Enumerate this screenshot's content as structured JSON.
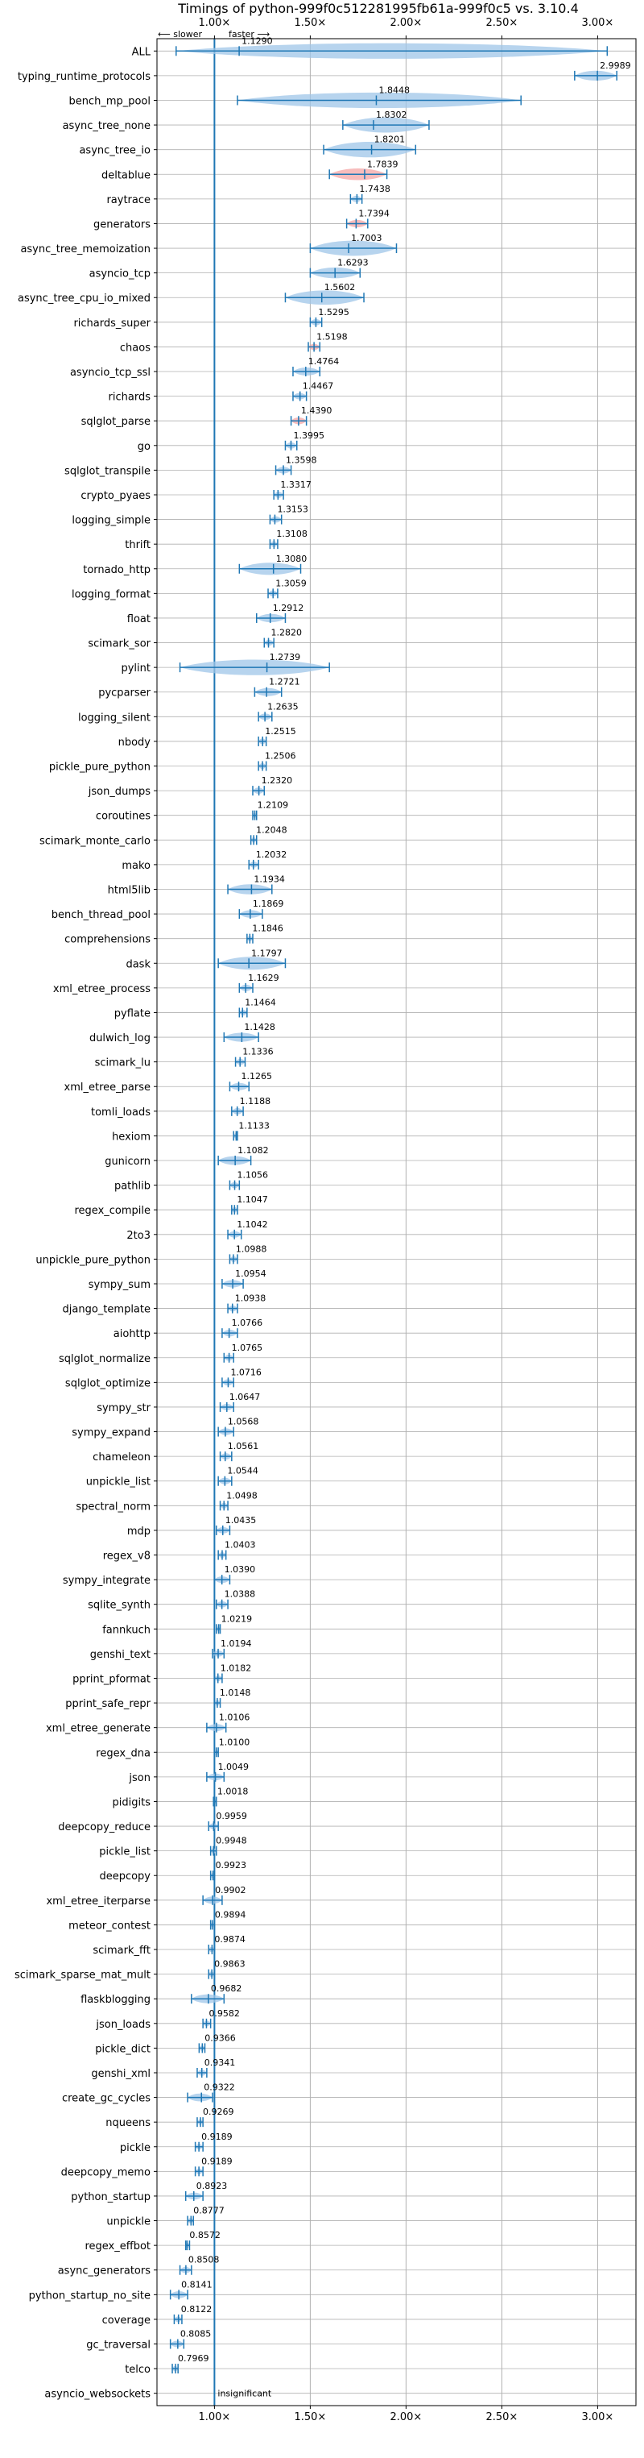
{
  "chart_data": {
    "type": "violin",
    "title": "Timings of python-999f0c512281995fb61a-999f0c5 vs. 3.10.4",
    "direction_labels": {
      "slower": "⟵ slower",
      "faster": "faster ⟶"
    },
    "x_ticks": [
      {
        "value": 1.0,
        "label": "1.00×"
      },
      {
        "value": 1.5,
        "label": "1.50×"
      },
      {
        "value": 2.0,
        "label": "2.00×"
      },
      {
        "value": 2.5,
        "label": "2.50×"
      },
      {
        "value": 3.0,
        "label": "3.00×"
      }
    ],
    "xlim": [
      0.7,
      3.2
    ],
    "grid": true,
    "colors": {
      "violin": "#9fc5e8",
      "line": "#1f77b4",
      "highlight": "#f4a6a6",
      "grid": "#b0b0b0"
    },
    "insignificant_label": "insignificant",
    "benchmarks": [
      {
        "name": "ALL",
        "value": 1.129,
        "label": "1.1290",
        "lo": 0.8,
        "hi": 3.05
      },
      {
        "name": "typing_runtime_protocols",
        "value": 2.9989,
        "label": "2.9989",
        "lo": 2.88,
        "hi": 3.1
      },
      {
        "name": "bench_mp_pool",
        "value": 1.8448,
        "label": "1.8448",
        "lo": 1.12,
        "hi": 2.6
      },
      {
        "name": "async_tree_none",
        "value": 1.8302,
        "label": "1.8302",
        "lo": 1.67,
        "hi": 2.12
      },
      {
        "name": "async_tree_io",
        "value": 1.8201,
        "label": "1.8201",
        "lo": 1.57,
        "hi": 2.05
      },
      {
        "name": "deltablue",
        "value": 1.7839,
        "label": "1.7839",
        "lo": 1.6,
        "hi": 1.9,
        "highlight": true
      },
      {
        "name": "raytrace",
        "value": 1.7438,
        "label": "1.7438",
        "lo": 1.71,
        "hi": 1.77
      },
      {
        "name": "generators",
        "value": 1.7394,
        "label": "1.7394",
        "lo": 1.69,
        "hi": 1.8,
        "highlight": true
      },
      {
        "name": "async_tree_memoization",
        "value": 1.7003,
        "label": "1.7003",
        "lo": 1.5,
        "hi": 1.95
      },
      {
        "name": "asyncio_tcp",
        "value": 1.6293,
        "label": "1.6293",
        "lo": 1.5,
        "hi": 1.76
      },
      {
        "name": "async_tree_cpu_io_mixed",
        "value": 1.5602,
        "label": "1.5602",
        "lo": 1.37,
        "hi": 1.78
      },
      {
        "name": "richards_super",
        "value": 1.5295,
        "label": "1.5295",
        "lo": 1.5,
        "hi": 1.56
      },
      {
        "name": "chaos",
        "value": 1.5198,
        "label": "1.5198",
        "lo": 1.49,
        "hi": 1.55,
        "highlight": true
      },
      {
        "name": "asyncio_tcp_ssl",
        "value": 1.4764,
        "label": "1.4764",
        "lo": 1.41,
        "hi": 1.55
      },
      {
        "name": "richards",
        "value": 1.4467,
        "label": "1.4467",
        "lo": 1.41,
        "hi": 1.48
      },
      {
        "name": "sqlglot_parse",
        "value": 1.439,
        "label": "1.4390",
        "lo": 1.4,
        "hi": 1.48,
        "highlight": true
      },
      {
        "name": "go",
        "value": 1.3995,
        "label": "1.3995",
        "lo": 1.37,
        "hi": 1.43
      },
      {
        "name": "sqlglot_transpile",
        "value": 1.3598,
        "label": "1.3598",
        "lo": 1.32,
        "hi": 1.4
      },
      {
        "name": "crypto_pyaes",
        "value": 1.3317,
        "label": "1.3317",
        "lo": 1.31,
        "hi": 1.36
      },
      {
        "name": "logging_simple",
        "value": 1.3153,
        "label": "1.3153",
        "lo": 1.29,
        "hi": 1.35
      },
      {
        "name": "thrift",
        "value": 1.3108,
        "label": "1.3108",
        "lo": 1.29,
        "hi": 1.33
      },
      {
        "name": "tornado_http",
        "value": 1.308,
        "label": "1.3080",
        "lo": 1.13,
        "hi": 1.45
      },
      {
        "name": "logging_format",
        "value": 1.3059,
        "label": "1.3059",
        "lo": 1.28,
        "hi": 1.33
      },
      {
        "name": "float",
        "value": 1.2912,
        "label": "1.2912",
        "lo": 1.22,
        "hi": 1.37
      },
      {
        "name": "scimark_sor",
        "value": 1.282,
        "label": "1.2820",
        "lo": 1.26,
        "hi": 1.31
      },
      {
        "name": "pylint",
        "value": 1.2739,
        "label": "1.2739",
        "lo": 0.82,
        "hi": 1.6
      },
      {
        "name": "pycparser",
        "value": 1.2721,
        "label": "1.2721",
        "lo": 1.21,
        "hi": 1.35
      },
      {
        "name": "logging_silent",
        "value": 1.2635,
        "label": "1.2635",
        "lo": 1.23,
        "hi": 1.3
      },
      {
        "name": "nbody",
        "value": 1.2515,
        "label": "1.2515",
        "lo": 1.23,
        "hi": 1.27
      },
      {
        "name": "pickle_pure_python",
        "value": 1.2506,
        "label": "1.2506",
        "lo": 1.23,
        "hi": 1.27
      },
      {
        "name": "json_dumps",
        "value": 1.232,
        "label": "1.2320",
        "lo": 1.2,
        "hi": 1.26
      },
      {
        "name": "coroutines",
        "value": 1.2109,
        "label": "1.2109",
        "lo": 1.2,
        "hi": 1.22
      },
      {
        "name": "scimark_monte_carlo",
        "value": 1.2048,
        "label": "1.2048",
        "lo": 1.19,
        "hi": 1.22
      },
      {
        "name": "mako",
        "value": 1.2032,
        "label": "1.2032",
        "lo": 1.18,
        "hi": 1.23
      },
      {
        "name": "html5lib",
        "value": 1.1934,
        "label": "1.1934",
        "lo": 1.07,
        "hi": 1.3
      },
      {
        "name": "bench_thread_pool",
        "value": 1.1869,
        "label": "1.1869",
        "lo": 1.13,
        "hi": 1.25
      },
      {
        "name": "comprehensions",
        "value": 1.1846,
        "label": "1.1846",
        "lo": 1.17,
        "hi": 1.2
      },
      {
        "name": "dask",
        "value": 1.1797,
        "label": "1.1797",
        "lo": 1.02,
        "hi": 1.37
      },
      {
        "name": "xml_etree_process",
        "value": 1.1629,
        "label": "1.1629",
        "lo": 1.13,
        "hi": 1.2
      },
      {
        "name": "pyflate",
        "value": 1.1464,
        "label": "1.1464",
        "lo": 1.13,
        "hi": 1.17
      },
      {
        "name": "dulwich_log",
        "value": 1.1428,
        "label": "1.1428",
        "lo": 1.05,
        "hi": 1.23
      },
      {
        "name": "scimark_lu",
        "value": 1.1336,
        "label": "1.1336",
        "lo": 1.11,
        "hi": 1.16
      },
      {
        "name": "xml_etree_parse",
        "value": 1.1265,
        "label": "1.1265",
        "lo": 1.08,
        "hi": 1.18
      },
      {
        "name": "tomli_loads",
        "value": 1.1188,
        "label": "1.1188",
        "lo": 1.09,
        "hi": 1.15
      },
      {
        "name": "hexiom",
        "value": 1.1133,
        "label": "1.1133",
        "lo": 1.1,
        "hi": 1.12
      },
      {
        "name": "gunicorn",
        "value": 1.1082,
        "label": "1.1082",
        "lo": 1.02,
        "hi": 1.19
      },
      {
        "name": "pathlib",
        "value": 1.1056,
        "label": "1.1056",
        "lo": 1.08,
        "hi": 1.13
      },
      {
        "name": "regex_compile",
        "value": 1.1047,
        "label": "1.1047",
        "lo": 1.09,
        "hi": 1.12
      },
      {
        "name": "2to3",
        "value": 1.1042,
        "label": "1.1042",
        "lo": 1.07,
        "hi": 1.14
      },
      {
        "name": "unpickle_pure_python",
        "value": 1.0988,
        "label": "1.0988",
        "lo": 1.08,
        "hi": 1.12
      },
      {
        "name": "sympy_sum",
        "value": 1.0954,
        "label": "1.0954",
        "lo": 1.04,
        "hi": 1.15
      },
      {
        "name": "django_template",
        "value": 1.0938,
        "label": "1.0938",
        "lo": 1.07,
        "hi": 1.12
      },
      {
        "name": "aiohttp",
        "value": 1.0766,
        "label": "1.0766",
        "lo": 1.04,
        "hi": 1.12
      },
      {
        "name": "sqlglot_normalize",
        "value": 1.0765,
        "label": "1.0765",
        "lo": 1.05,
        "hi": 1.1
      },
      {
        "name": "sqlglot_optimize",
        "value": 1.0716,
        "label": "1.0716",
        "lo": 1.04,
        "hi": 1.1
      },
      {
        "name": "sympy_str",
        "value": 1.0647,
        "label": "1.0647",
        "lo": 1.03,
        "hi": 1.1
      },
      {
        "name": "sympy_expand",
        "value": 1.0568,
        "label": "1.0568",
        "lo": 1.02,
        "hi": 1.1
      },
      {
        "name": "chameleon",
        "value": 1.0561,
        "label": "1.0561",
        "lo": 1.03,
        "hi": 1.09
      },
      {
        "name": "unpickle_list",
        "value": 1.0544,
        "label": "1.0544",
        "lo": 1.02,
        "hi": 1.09
      },
      {
        "name": "spectral_norm",
        "value": 1.0498,
        "label": "1.0498",
        "lo": 1.03,
        "hi": 1.07
      },
      {
        "name": "mdp",
        "value": 1.0435,
        "label": "1.0435",
        "lo": 1.01,
        "hi": 1.08
      },
      {
        "name": "regex_v8",
        "value": 1.0403,
        "label": "1.0403",
        "lo": 1.02,
        "hi": 1.06
      },
      {
        "name": "sympy_integrate",
        "value": 1.039,
        "label": "1.0390",
        "lo": 1.0,
        "hi": 1.08
      },
      {
        "name": "sqlite_synth",
        "value": 1.0388,
        "label": "1.0388",
        "lo": 1.01,
        "hi": 1.07
      },
      {
        "name": "fannkuch",
        "value": 1.0219,
        "label": "1.0219",
        "lo": 1.01,
        "hi": 1.03
      },
      {
        "name": "genshi_text",
        "value": 1.0194,
        "label": "1.0194",
        "lo": 0.99,
        "hi": 1.05
      },
      {
        "name": "pprint_pformat",
        "value": 1.0182,
        "label": "1.0182",
        "lo": 1.0,
        "hi": 1.04
      },
      {
        "name": "pprint_safe_repr",
        "value": 1.0148,
        "label": "1.0148",
        "lo": 1.0,
        "hi": 1.03
      },
      {
        "name": "xml_etree_generate",
        "value": 1.0106,
        "label": "1.0106",
        "lo": 0.96,
        "hi": 1.06
      },
      {
        "name": "regex_dna",
        "value": 1.01,
        "label": "1.0100",
        "lo": 1.0,
        "hi": 1.02
      },
      {
        "name": "json",
        "value": 1.0049,
        "label": "1.0049",
        "lo": 0.96,
        "hi": 1.05
      },
      {
        "name": "pidigits",
        "value": 1.0018,
        "label": "1.0018",
        "lo": 0.995,
        "hi": 1.01
      },
      {
        "name": "deepcopy_reduce",
        "value": 0.9959,
        "label": "0.9959",
        "lo": 0.97,
        "hi": 1.02
      },
      {
        "name": "pickle_list",
        "value": 0.9948,
        "label": "0.9948",
        "lo": 0.98,
        "hi": 1.01
      },
      {
        "name": "deepcopy",
        "value": 0.9923,
        "label": "0.9923",
        "lo": 0.98,
        "hi": 1.0
      },
      {
        "name": "xml_etree_iterparse",
        "value": 0.9902,
        "label": "0.9902",
        "lo": 0.94,
        "hi": 1.04
      },
      {
        "name": "meteor_contest",
        "value": 0.9894,
        "label": "0.9894",
        "lo": 0.98,
        "hi": 1.0
      },
      {
        "name": "scimark_fft",
        "value": 0.9874,
        "label": "0.9874",
        "lo": 0.97,
        "hi": 1.0
      },
      {
        "name": "scimark_sparse_mat_mult",
        "value": 0.9863,
        "label": "0.9863",
        "lo": 0.97,
        "hi": 1.0
      },
      {
        "name": "flaskblogging",
        "value": 0.9682,
        "label": "0.9682",
        "lo": 0.88,
        "hi": 1.05
      },
      {
        "name": "json_loads",
        "value": 0.9582,
        "label": "0.9582",
        "lo": 0.94,
        "hi": 0.98
      },
      {
        "name": "pickle_dict",
        "value": 0.9366,
        "label": "0.9366",
        "lo": 0.92,
        "hi": 0.95
      },
      {
        "name": "genshi_xml",
        "value": 0.9341,
        "label": "0.9341",
        "lo": 0.91,
        "hi": 0.96
      },
      {
        "name": "create_gc_cycles",
        "value": 0.9322,
        "label": "0.9322",
        "lo": 0.86,
        "hi": 0.99
      },
      {
        "name": "nqueens",
        "value": 0.9269,
        "label": "0.9269",
        "lo": 0.91,
        "hi": 0.94
      },
      {
        "name": "pickle",
        "value": 0.9189,
        "label": "0.9189",
        "lo": 0.9,
        "hi": 0.94
      },
      {
        "name": "deepcopy_memo",
        "value": 0.9189,
        "label": "0.9189",
        "lo": 0.9,
        "hi": 0.94
      },
      {
        "name": "python_startup",
        "value": 0.8923,
        "label": "0.8923",
        "lo": 0.85,
        "hi": 0.94
      },
      {
        "name": "unpickle",
        "value": 0.8777,
        "label": "0.8777",
        "lo": 0.86,
        "hi": 0.89
      },
      {
        "name": "regex_effbot",
        "value": 0.8572,
        "label": "0.8572",
        "lo": 0.85,
        "hi": 0.87
      },
      {
        "name": "async_generators",
        "value": 0.8508,
        "label": "0.8508",
        "lo": 0.82,
        "hi": 0.88
      },
      {
        "name": "python_startup_no_site",
        "value": 0.8141,
        "label": "0.8141",
        "lo": 0.77,
        "hi": 0.86
      },
      {
        "name": "coverage",
        "value": 0.8122,
        "label": "0.8122",
        "lo": 0.79,
        "hi": 0.83
      },
      {
        "name": "gc_traversal",
        "value": 0.8085,
        "label": "0.8085",
        "lo": 0.77,
        "hi": 0.84
      },
      {
        "name": "telco",
        "value": 0.7969,
        "label": "0.7969",
        "lo": 0.78,
        "hi": 0.81
      },
      {
        "name": "asyncio_websockets",
        "value": null,
        "label": "",
        "insignificant": true
      }
    ]
  }
}
